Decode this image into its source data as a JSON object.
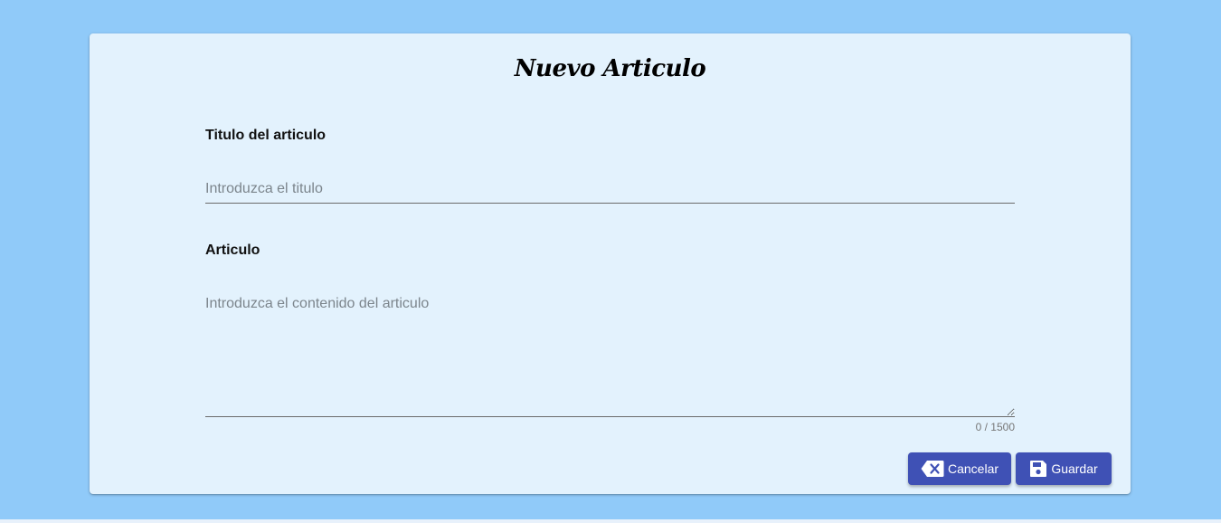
{
  "page": {
    "title": "Nuevo Articulo"
  },
  "form": {
    "title_label": "Titulo del articulo",
    "title_placeholder": "Introduzca el titulo",
    "title_value": "",
    "article_label": "Articulo",
    "article_placeholder": "Introduzca el contenido del articulo",
    "article_value": "",
    "char_counter": "0 / 1500"
  },
  "actions": {
    "cancel_label": "Cancelar",
    "cancel_icon": "backspace-icon",
    "save_label": "Guardar",
    "save_icon": "save-icon"
  },
  "colors": {
    "background": "#90caf9",
    "card": "#e3f2fd",
    "primary": "#3f51b5"
  }
}
